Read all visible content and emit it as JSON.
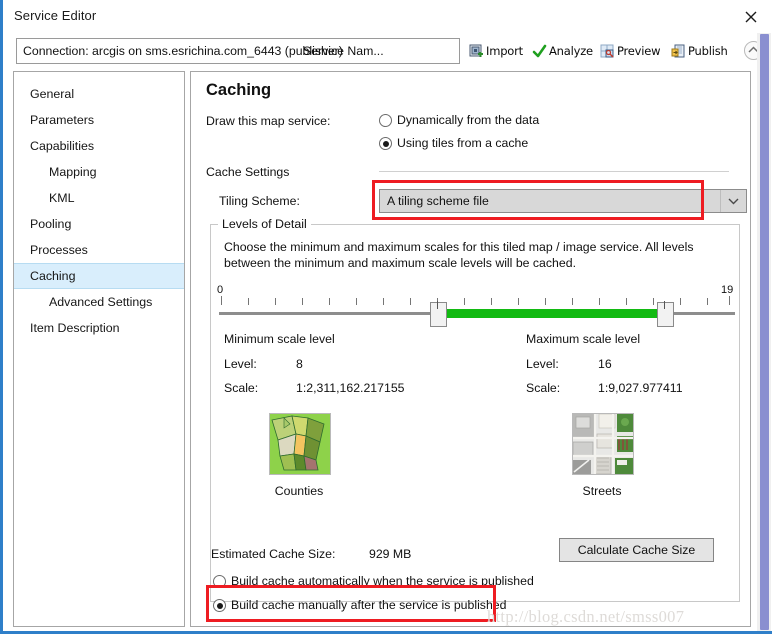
{
  "window": {
    "title": "Service Editor",
    "close_icon": "close-icon",
    "accent_color": "#2f7fc9"
  },
  "toolbar": {
    "connection_text": "Connection: arcgis on sms.esrichina.com_6443 (publisher)",
    "service_name_text": "Service Nam...",
    "actions": [
      {
        "label": "Import",
        "icon": "import-icon"
      },
      {
        "label": "Analyze",
        "icon": "checkmark-icon"
      },
      {
        "label": "Preview",
        "icon": "preview-icon"
      },
      {
        "label": "Publish",
        "icon": "publish-icon"
      }
    ],
    "collapse_icon": "chevron-up-icon"
  },
  "sidebar": {
    "selected": "Caching",
    "items": [
      {
        "label": "General",
        "indent": false
      },
      {
        "label": "Parameters",
        "indent": false
      },
      {
        "label": "Capabilities",
        "indent": false
      },
      {
        "label": "Mapping",
        "indent": true
      },
      {
        "label": "KML",
        "indent": true
      },
      {
        "label": "Pooling",
        "indent": false
      },
      {
        "label": "Processes",
        "indent": false
      },
      {
        "label": "Caching",
        "indent": false
      },
      {
        "label": "Advanced Settings",
        "indent": true
      },
      {
        "label": "Item Description",
        "indent": false
      }
    ]
  },
  "main": {
    "heading": "Caching",
    "draw_label": "Draw this map service:",
    "draw_options": [
      {
        "label": "Dynamically from the data",
        "selected": false
      },
      {
        "label": "Using tiles from a cache",
        "selected": true
      }
    ],
    "cache_settings_label": "Cache Settings",
    "tiling_scheme_label": "Tiling Scheme:",
    "tiling_scheme_value": "A tiling scheme file",
    "tiling_scheme_dropdown_icon": "chevron-down-icon",
    "levels_group_title": "Levels of Detail",
    "levels_description": "Choose the minimum and maximum scales for this tiled map / image service. All levels between the minimum and maximum scale levels will be cached.",
    "slider": {
      "min_tick_label": "0",
      "max_tick_label": "19",
      "min_value": 8,
      "max_value": 16,
      "range_start": 0,
      "range_end": 19,
      "fill_color": "#12ba12"
    },
    "minimum": {
      "title": "Minimum scale level",
      "level_key": "Level:",
      "level_value": "8",
      "scale_key": "Scale:",
      "scale_value": "1:2,311,162.217155",
      "thumb_caption": "Counties"
    },
    "maximum": {
      "title": "Maximum scale level",
      "level_key": "Level:",
      "level_value": "16",
      "scale_key": "Scale:",
      "scale_value": "1:9,027.977411",
      "thumb_caption": "Streets"
    },
    "estimated_label": "Estimated Cache Size:",
    "estimated_value": "929 MB",
    "calculate_button": "Calculate Cache Size",
    "build_options": [
      {
        "label": "Build cache automatically when the service is published",
        "selected": false
      },
      {
        "label": "Build cache manually after the service is published",
        "selected": true
      }
    ]
  },
  "annotations": {
    "highlight_color": "#ee1c22",
    "watermark": "http://blog.csdn.net/smss007"
  }
}
